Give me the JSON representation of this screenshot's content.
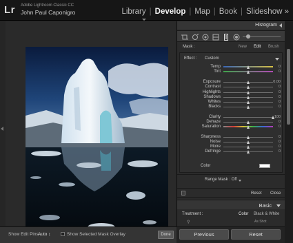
{
  "app": {
    "logo": "Lr",
    "product_name": "Adobe Lightroom Classic CC",
    "user_name": "John Paul Caponigro"
  },
  "modules": {
    "library": "Library",
    "develop": "Develop",
    "map": "Map",
    "book": "Book",
    "slideshow": "Slideshow »",
    "separator": "|"
  },
  "histogram": {
    "title": "Histogram"
  },
  "mask": {
    "label": "Mask :",
    "new": "New",
    "edit": "Edit",
    "brush": "Brush"
  },
  "effect": {
    "label": "Effect :",
    "value": "Custom"
  },
  "sliders": [
    {
      "label": "Temp",
      "value": "0",
      "knob": 0.5,
      "gradient": "linear-gradient(90deg,#3a67b8,#d8c244)"
    },
    {
      "label": "Tint",
      "value": "0",
      "knob": 0.5,
      "gradient": "linear-gradient(90deg,#3fa34a,#b24bb6)"
    },
    {
      "label": "Exposure",
      "value": "0.00",
      "knob": 0.5,
      "gradient": ""
    },
    {
      "label": "Contrast",
      "value": "0",
      "knob": 0.5,
      "gradient": ""
    },
    {
      "label": "Highlights",
      "value": "0",
      "knob": 0.5,
      "gradient": ""
    },
    {
      "label": "Shadows",
      "value": "0",
      "knob": 0.5,
      "gradient": ""
    },
    {
      "label": "Whites",
      "value": "0",
      "knob": 0.5,
      "gradient": ""
    },
    {
      "label": "Blacks",
      "value": "0",
      "knob": 0.5,
      "gradient": ""
    },
    {
      "label": "Clarity",
      "value": "100",
      "knob": 1.0,
      "gradient": ""
    },
    {
      "label": "Dehaze",
      "value": "0",
      "knob": 0.5,
      "gradient": ""
    },
    {
      "label": "Saturation",
      "value": "0",
      "knob": 0.5,
      "gradient": "linear-gradient(90deg,#888,#d23a3a,#d7c23a,#3ab04a,#3a6ad8,#b83ab8)"
    },
    {
      "label": "Sharpness",
      "value": "0",
      "knob": 0.5,
      "gradient": ""
    },
    {
      "label": "Noise",
      "value": "0",
      "knob": 0.5,
      "gradient": ""
    },
    {
      "label": "Moire",
      "value": "0",
      "knob": 0.5,
      "gradient": ""
    },
    {
      "label": "Defringe",
      "value": "0",
      "knob": 0.5,
      "gradient": ""
    }
  ],
  "color": {
    "label": "Color"
  },
  "range_mask": {
    "label": "Range Mask : Off"
  },
  "panel_actions": {
    "reset": "Reset",
    "close": "Close"
  },
  "basic": {
    "title": "Basic"
  },
  "treatment": {
    "label": "Treatment :",
    "color": "Color",
    "bw": "Black & White"
  },
  "profile": {
    "value": "As Shot"
  },
  "toolbar": {
    "show_pins_label": "Show Edit Pins :",
    "show_pins_value": "Auto ↕",
    "overlay_label": "Show Selected Mask Overlay",
    "done": "Done"
  },
  "bottom": {
    "previous": "Previous",
    "reset": "Reset"
  }
}
